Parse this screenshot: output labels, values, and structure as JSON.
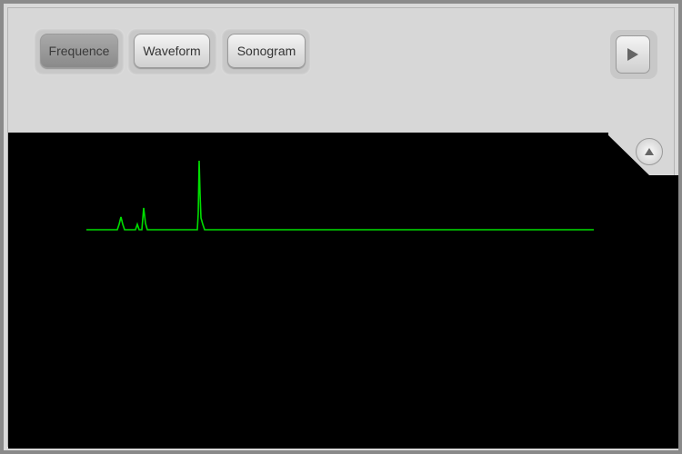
{
  "tabs": [
    {
      "label": "Frequence",
      "active": true
    },
    {
      "label": "Waveform",
      "active": false
    },
    {
      "label": "Sonogram",
      "active": false
    }
  ],
  "controls": {
    "play_icon": "play-icon",
    "collapse_icon": "collapse-up-icon"
  },
  "colors": {
    "scope_background": "#000000",
    "trace": "#00dd00",
    "panel": "#d7d7d7"
  }
}
